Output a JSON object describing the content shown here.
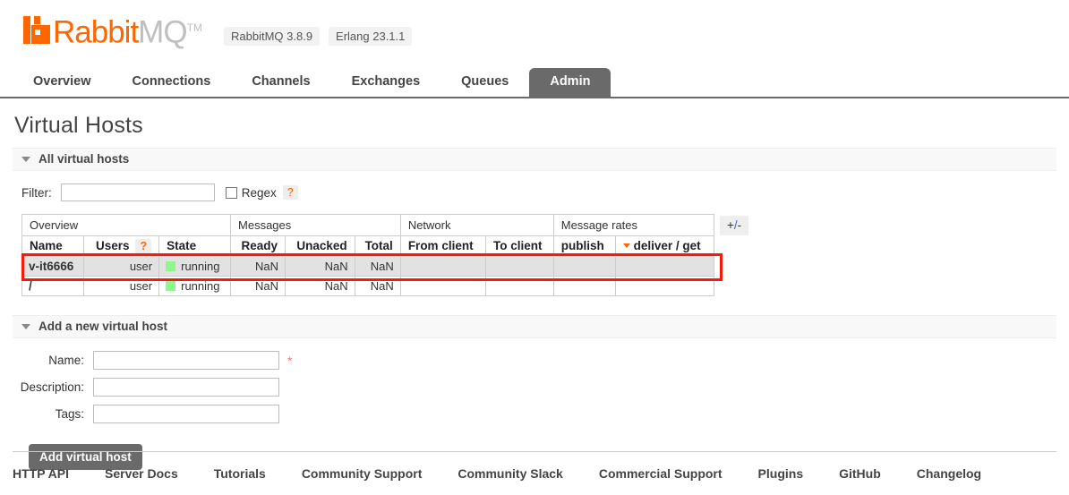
{
  "brand": {
    "name_part1": "Rabbit",
    "name_part2": "MQ",
    "trademark": "TM",
    "logo_icon": "rabbitmq-logo-icon",
    "accent_color": "#ff6600"
  },
  "versions": [
    {
      "label": "RabbitMQ 3.8.9"
    },
    {
      "label": "Erlang 23.1.1"
    }
  ],
  "nav": {
    "items": [
      {
        "label": "Overview",
        "active": false
      },
      {
        "label": "Connections",
        "active": false
      },
      {
        "label": "Channels",
        "active": false
      },
      {
        "label": "Exchanges",
        "active": false
      },
      {
        "label": "Queues",
        "active": false
      },
      {
        "label": "Admin",
        "active": true
      }
    ],
    "active_color": "#6a6a6a"
  },
  "page": {
    "title": "Virtual Hosts"
  },
  "all_vhosts": {
    "section_label": "All virtual hosts",
    "filter": {
      "label": "Filter:",
      "value": "",
      "placeholder": "",
      "regex_label": "Regex",
      "regex_checked": false,
      "help_label": "?"
    },
    "toggle_columns_label": "+/-",
    "group_headers": [
      {
        "label": "Overview",
        "span": 3
      },
      {
        "label": "Messages",
        "span": 3
      },
      {
        "label": "Network",
        "span": 2
      },
      {
        "label": "Message rates",
        "span": 2
      }
    ],
    "columns": [
      {
        "label": "Name",
        "align": "left",
        "help": false,
        "sorted": false
      },
      {
        "label": "Users",
        "align": "right",
        "help": true,
        "help_label": "?",
        "sorted": false
      },
      {
        "label": "State",
        "align": "left",
        "help": false,
        "sorted": false
      },
      {
        "label": "Ready",
        "align": "right",
        "help": false,
        "sorted": false
      },
      {
        "label": "Unacked",
        "align": "right",
        "help": false,
        "sorted": false
      },
      {
        "label": "Total",
        "align": "right",
        "help": false,
        "sorted": false
      },
      {
        "label": "From client",
        "align": "left",
        "help": false,
        "sorted": false
      },
      {
        "label": "To client",
        "align": "left",
        "help": false,
        "sorted": false
      },
      {
        "label": "publish",
        "align": "left",
        "help": false,
        "sorted": false
      },
      {
        "label": "deliver / get",
        "align": "left",
        "help": false,
        "sorted": true,
        "sort_dir": "desc"
      }
    ],
    "rows": [
      {
        "name": "v-it6666",
        "users": "user",
        "state": "running",
        "state_color": "#8ef78e",
        "ready": "NaN",
        "unacked": "NaN",
        "total": "NaN",
        "from_client": "",
        "to_client": "",
        "publish": "",
        "deliver_get": "",
        "highlighted": true
      },
      {
        "name": "/",
        "users": "user",
        "state": "running",
        "state_color": "#8ef78e",
        "ready": "NaN",
        "unacked": "NaN",
        "total": "NaN",
        "from_client": "",
        "to_client": "",
        "publish": "",
        "deliver_get": "",
        "highlighted": false
      }
    ],
    "annotation": {
      "type": "rectangle",
      "color": "#f41b0c",
      "targets_row": "v-it6666"
    }
  },
  "add_vhost": {
    "section_label": "Add a new virtual host",
    "fields": [
      {
        "label": "Name:",
        "value": "",
        "placeholder": "",
        "required": true,
        "required_marker": "*"
      },
      {
        "label": "Description:",
        "value": "",
        "placeholder": "",
        "required": false
      },
      {
        "label": "Tags:",
        "value": "",
        "placeholder": "",
        "required": false
      }
    ],
    "submit_label": "Add virtual host"
  },
  "footer": {
    "links": [
      {
        "label": "HTTP API"
      },
      {
        "label": "Server Docs"
      },
      {
        "label": "Tutorials"
      },
      {
        "label": "Community Support"
      },
      {
        "label": "Community Slack"
      },
      {
        "label": "Commercial Support"
      },
      {
        "label": "Plugins"
      },
      {
        "label": "GitHub"
      },
      {
        "label": "Changelog"
      }
    ]
  }
}
